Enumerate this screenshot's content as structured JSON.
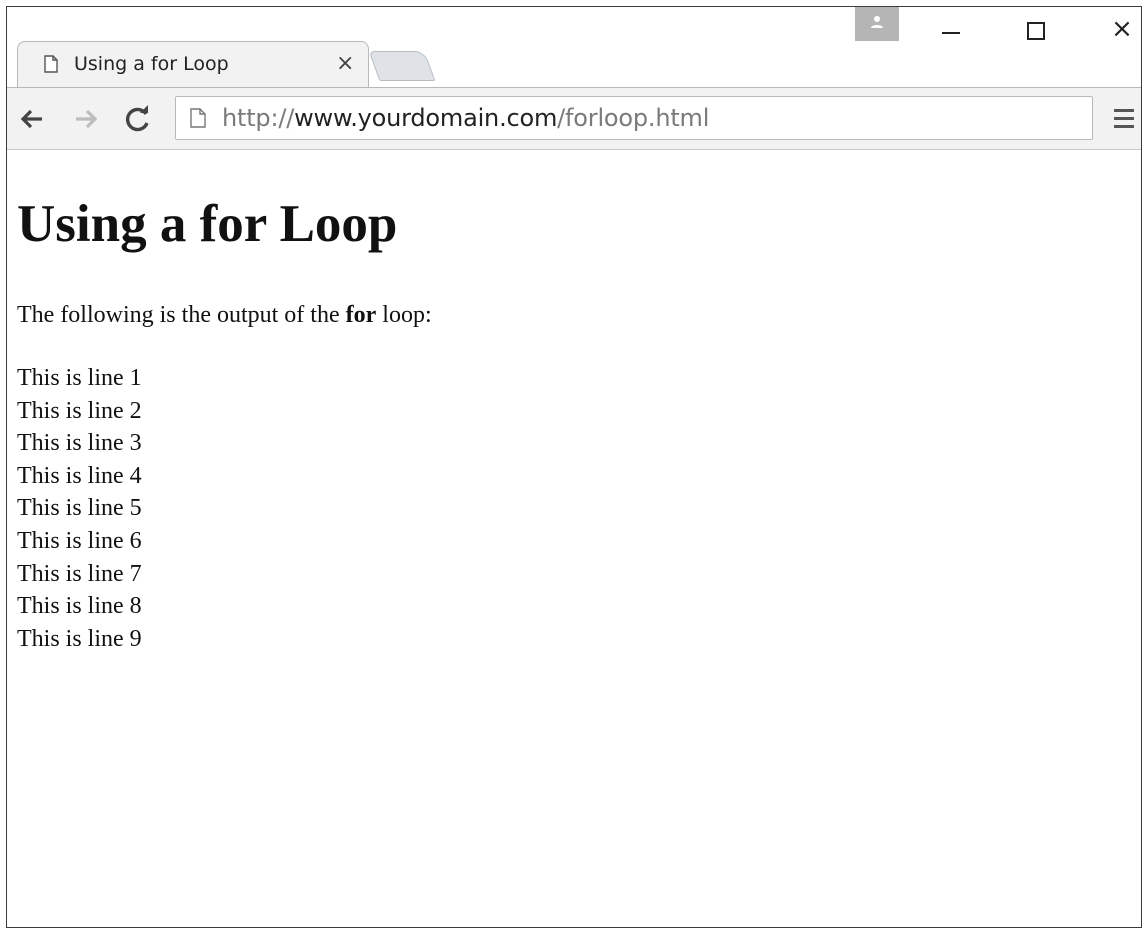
{
  "browser": {
    "tab": {
      "title": "Using a for Loop",
      "close_label": "×",
      "icon": "page-icon"
    },
    "window_controls": {
      "close_label": "×"
    },
    "toolbar": {
      "back_icon": "arrow-left-icon",
      "forward_icon": "arrow-right-icon",
      "reload_icon": "reload-icon",
      "menu_icon": "hamburger-menu-icon"
    },
    "address_bar": {
      "scheme": "http://",
      "host": "www.yourdomain.com",
      "path": "/forloop.html"
    }
  },
  "page": {
    "heading": "Using a for Loop",
    "intro_before": "The following is the output of the ",
    "intro_bold": "for",
    "intro_after": " loop:",
    "lines": [
      "This is line 1",
      "This is line 2",
      "This is line 3",
      "This is line 4",
      "This is line 5",
      "This is line 6",
      "This is line 7",
      "This is line 8",
      "This is line 9"
    ]
  },
  "colors": {
    "chrome_background": "#f2f2f2",
    "url_host": "#222222",
    "url_muted": "#7a7a7a",
    "page_text": "#111111"
  }
}
